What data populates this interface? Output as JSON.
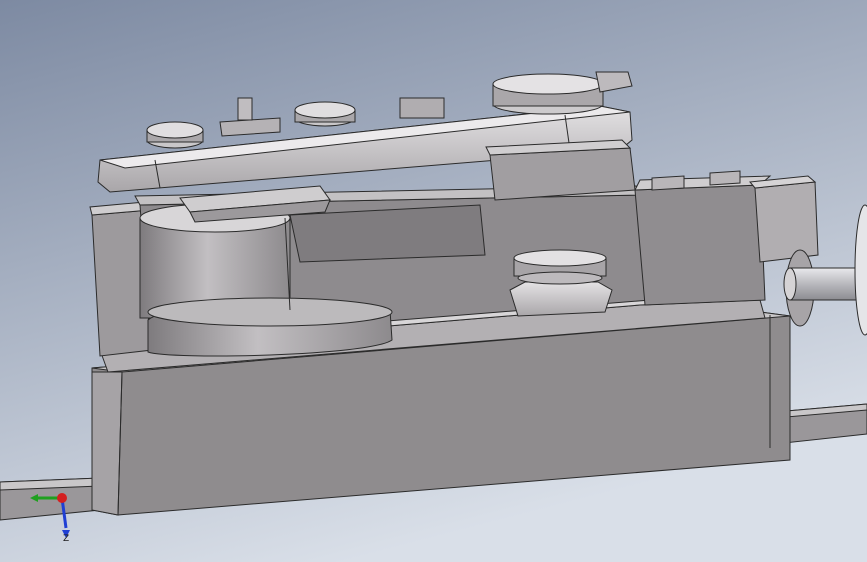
{
  "viewport": {
    "background_top": "#7d8aa2",
    "background_bottom": "#d9dfe8"
  },
  "model": {
    "body_color": "#8f8c8e",
    "body_light": "#c9c7c9",
    "body_dark": "#6c6a6d",
    "edge_color": "#2b2b2b"
  },
  "triad": {
    "axis_x_color": "#d42020",
    "axis_y_color": "#1fa01f",
    "axis_z_color": "#1f3fd4",
    "z_label": "Z"
  }
}
